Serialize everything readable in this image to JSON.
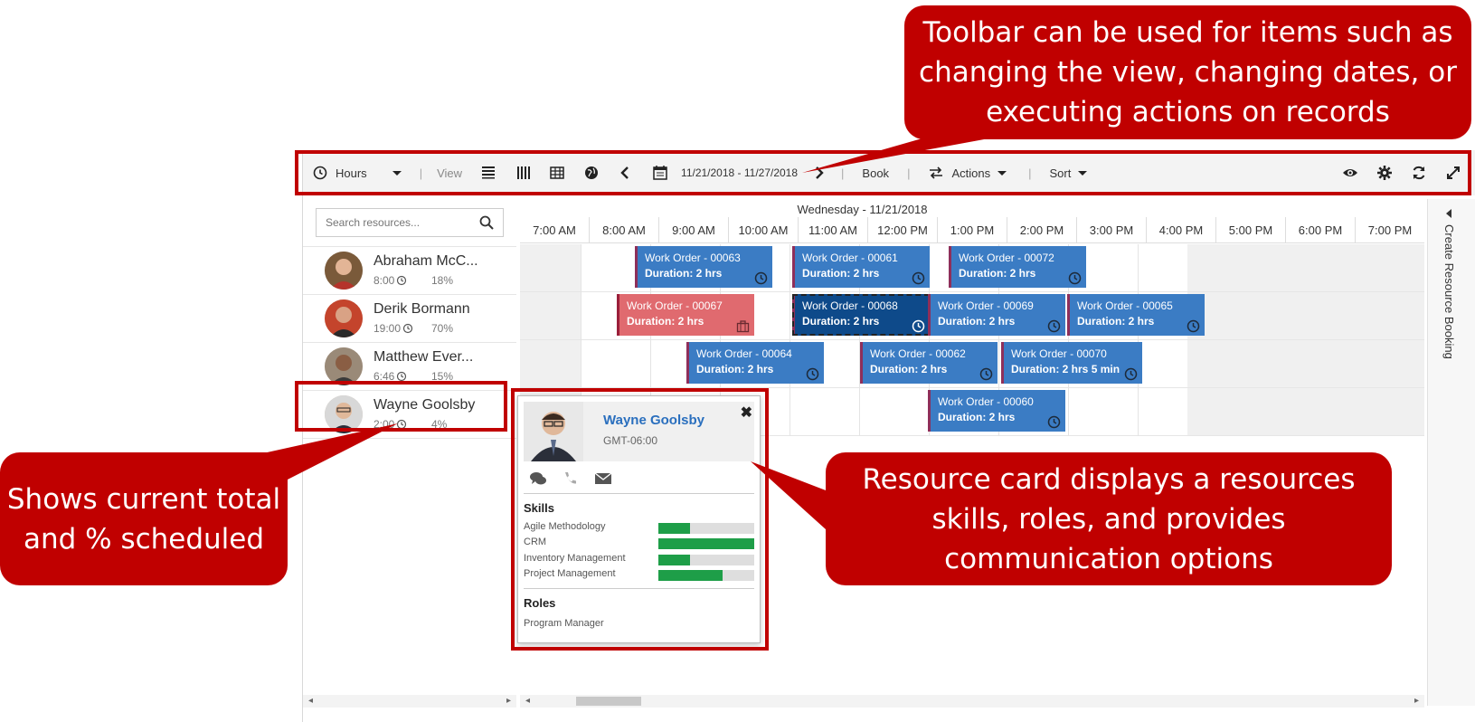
{
  "callouts": {
    "toolbar": "Toolbar can be used for items such as changing the view, changing dates, or executing actions on records",
    "totals": "Shows current total and % scheduled",
    "card": "Resource card displays a resources skills, roles, and provides communication options"
  },
  "toolbar": {
    "hours_label": "Hours",
    "view_label": "View",
    "date_range": "11/21/2018 - 11/27/2018",
    "book_label": "Book",
    "actions_label": "Actions",
    "sort_label": "Sort",
    "separator": "|"
  },
  "search": {
    "placeholder": "Search resources..."
  },
  "resources": [
    {
      "name": "Abraham McC...",
      "hours": "8:00",
      "pct": "18%"
    },
    {
      "name": "Derik Bormann",
      "hours": "19:00",
      "pct": "70%"
    },
    {
      "name": "Matthew Ever...",
      "hours": "6:46",
      "pct": "15%"
    },
    {
      "name": "Wayne Goolsby",
      "hours": "2:00",
      "pct": "4%"
    }
  ],
  "schedule": {
    "day_label": "Wednesday - 11/21/2018",
    "hours": [
      "7:00 AM",
      "8:00 AM",
      "9:00 AM",
      "10:00 AM",
      "11:00 AM",
      "12:00 PM",
      "1:00 PM",
      "2:00 PM",
      "3:00 PM",
      "4:00 PM",
      "5:00 PM",
      "6:00 PM",
      "7:00 PM"
    ],
    "work_orders": [
      {
        "title": "Work Order - 00063",
        "duration_label": "Duration:",
        "duration": "2 hrs"
      },
      {
        "title": "Work Order - 00061",
        "duration_label": "Duration:",
        "duration": "2 hrs"
      },
      {
        "title": "Work Order - 00072",
        "duration_label": "Duration:",
        "duration": "2 hrs"
      },
      {
        "title": "Work Order - 00067",
        "duration_label": "Duration:",
        "duration": "2 hrs"
      },
      {
        "title": "Work Order - 00068",
        "duration_label": "Duration:",
        "duration": "2 hrs"
      },
      {
        "title": "Work Order - 00069",
        "duration_label": "Duration:",
        "duration": "2 hrs"
      },
      {
        "title": "Work Order - 00065",
        "duration_label": "Duration:",
        "duration": "2 hrs"
      },
      {
        "title": "Work Order - 00064",
        "duration_label": "Duration:",
        "duration": "2 hrs"
      },
      {
        "title": "Work Order - 00062",
        "duration_label": "Duration:",
        "duration": "2 hrs"
      },
      {
        "title": "Work Order - 00070",
        "duration_label": "Duration:",
        "duration": "2 hrs 5 min"
      },
      {
        "title": "Work Order - 00060",
        "duration_label": "Duration:",
        "duration": "2 hrs"
      }
    ]
  },
  "card": {
    "name": "Wayne Goolsby",
    "timezone": "GMT-06:00",
    "close": "✖",
    "skills_heading": "Skills",
    "skills": [
      {
        "name": "Agile Methodology",
        "level": 0.33
      },
      {
        "name": "CRM",
        "level": 1.0
      },
      {
        "name": "Inventory Management",
        "level": 0.33
      },
      {
        "name": "Project Management",
        "level": 0.67
      }
    ],
    "roles_heading": "Roles",
    "roles": [
      "Program Manager"
    ]
  },
  "side_panel": {
    "label": "Create Resource Booking"
  },
  "colors": {
    "callout": "#c00000",
    "work_order": "#3b7cc4",
    "work_order_red": "#e06a6f",
    "selected": "#0e4a8a",
    "skill_fill": "#1e9e48",
    "link": "#2a6fbe"
  }
}
